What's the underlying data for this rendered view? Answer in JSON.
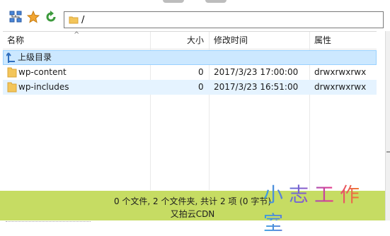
{
  "toolbar": {
    "path": "/"
  },
  "columns": {
    "name": "名称",
    "size": "大小",
    "modified": "修改时间",
    "attributes": "属性"
  },
  "parent_row": {
    "label": "上级目录"
  },
  "rows": [
    {
      "name": "wp-content",
      "size": "0",
      "modified": "2017/3/23 17:00:00",
      "attributes": "drwxrwxrwx"
    },
    {
      "name": "wp-includes",
      "size": "0",
      "modified": "2017/3/23 16:51:00",
      "attributes": "drwxrwxrwx"
    }
  ],
  "status": {
    "summary": "0 个文件, 2 个文件夹, 共计 2 项 (0 字节)",
    "provider": "又拍云CDN"
  },
  "watermark": "小志工作室",
  "colors": {
    "status_bar": "#c6dc63",
    "selected_row": "#cce8ff",
    "folder": "#f3c55a"
  }
}
